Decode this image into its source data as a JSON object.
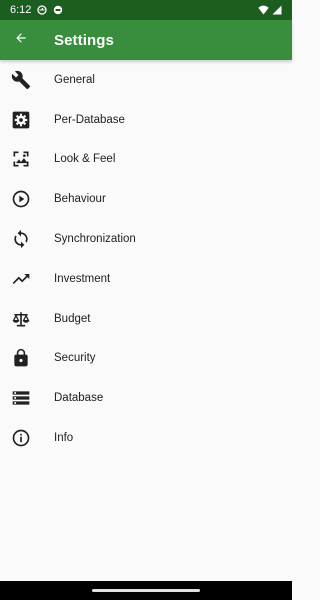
{
  "status_bar": {
    "time": "6:12",
    "icons": [
      "sync-status-icon",
      "record-status-icon",
      "wifi-icon",
      "cellular-signal-icon"
    ]
  },
  "app_bar": {
    "title": "Settings",
    "back_icon": "arrow-back-icon"
  },
  "settings": {
    "items": [
      {
        "label": "General",
        "icon": "wrench-icon"
      },
      {
        "label": "Per-Database",
        "icon": "gear-box-icon"
      },
      {
        "label": "Look & Feel",
        "icon": "image-frame-icon"
      },
      {
        "label": "Behaviour",
        "icon": "play-circle-icon"
      },
      {
        "label": "Synchronization",
        "icon": "sync-icon"
      },
      {
        "label": "Investment",
        "icon": "trending-up-icon"
      },
      {
        "label": "Budget",
        "icon": "scale-icon"
      },
      {
        "label": "Security",
        "icon": "lock-icon"
      },
      {
        "label": "Database",
        "icon": "storage-icon"
      },
      {
        "label": "Info",
        "icon": "info-icon"
      }
    ]
  },
  "colors": {
    "status_bar": "#1b5e20",
    "app_bar": "#388e3c",
    "background": "#fafafa",
    "icon": "#212121"
  }
}
